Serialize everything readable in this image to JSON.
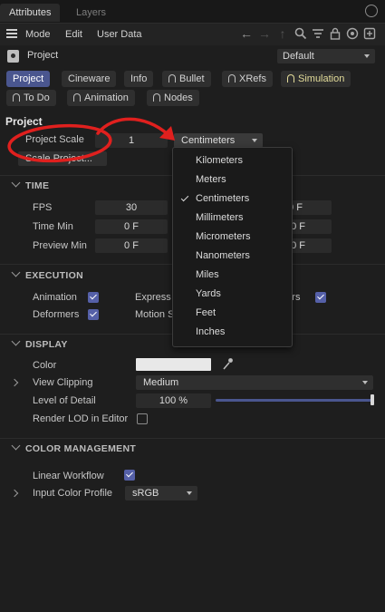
{
  "tabs": [
    "Attributes",
    "Layers"
  ],
  "menu": [
    "Mode",
    "Edit",
    "User Data"
  ],
  "toolbar_icons": [
    "back-arrow-icon",
    "forward-arrow-icon",
    "up-arrow-icon",
    "search-icon",
    "filter-icon",
    "lock-icon",
    "target-icon",
    "add-icon"
  ],
  "header": {
    "object": "Project",
    "preset": "Default"
  },
  "chips": [
    {
      "label": "Project",
      "icon": false,
      "active": true
    },
    {
      "label": "Cineware",
      "icon": false
    },
    {
      "label": "Info",
      "icon": false
    },
    {
      "label": "Bullet",
      "icon": true
    },
    {
      "label": "XRefs",
      "icon": true
    },
    {
      "label": "Simulation",
      "icon": true,
      "highlight": true
    },
    {
      "label": "To Do",
      "icon": true
    },
    {
      "label": "Animation",
      "icon": true
    },
    {
      "label": "Nodes",
      "icon": true
    }
  ],
  "project": {
    "title": "Project",
    "scale_label": "Project Scale",
    "scale_value": "1",
    "unit": "Centimeters",
    "scale_button": "Scale Project..."
  },
  "units_menu": {
    "options": [
      "Kilometers",
      "Meters",
      "Centimeters",
      "Millimeters",
      "Micrometers",
      "Nanometers",
      "Miles",
      "Yards",
      "Feet",
      "Inches"
    ],
    "selected": "Centimeters"
  },
  "time": {
    "title": "TIME",
    "fps_label": "FPS",
    "fps": "30",
    "min_label": "Time Min",
    "min": "0 F",
    "preview_label": "Preview Min",
    "preview_min": "0 F",
    "right_col": [
      "0 F",
      "90 F",
      "90 F"
    ]
  },
  "execution": {
    "title": "EXECUTION",
    "animation": "Animation",
    "express": "Express",
    "generators": "enerators",
    "deformers": "Deformers",
    "motion": "Motion S"
  },
  "display": {
    "title": "DISPLAY",
    "color_label": "Color",
    "color_value": "#e8e8e8",
    "clipping_label": "View Clipping",
    "clipping": "Medium",
    "lod_label": "Level of Detail",
    "lod": "100 %",
    "lod_fraction": 1.0,
    "render_lod": "Render LOD in Editor"
  },
  "color_mgmt": {
    "title": "COLOR MANAGEMENT",
    "linear": "Linear Workflow",
    "input_label": "Input Color Profile",
    "input": "sRGB"
  },
  "annotation_color": "#e0201e",
  "accent": "#4a568f"
}
